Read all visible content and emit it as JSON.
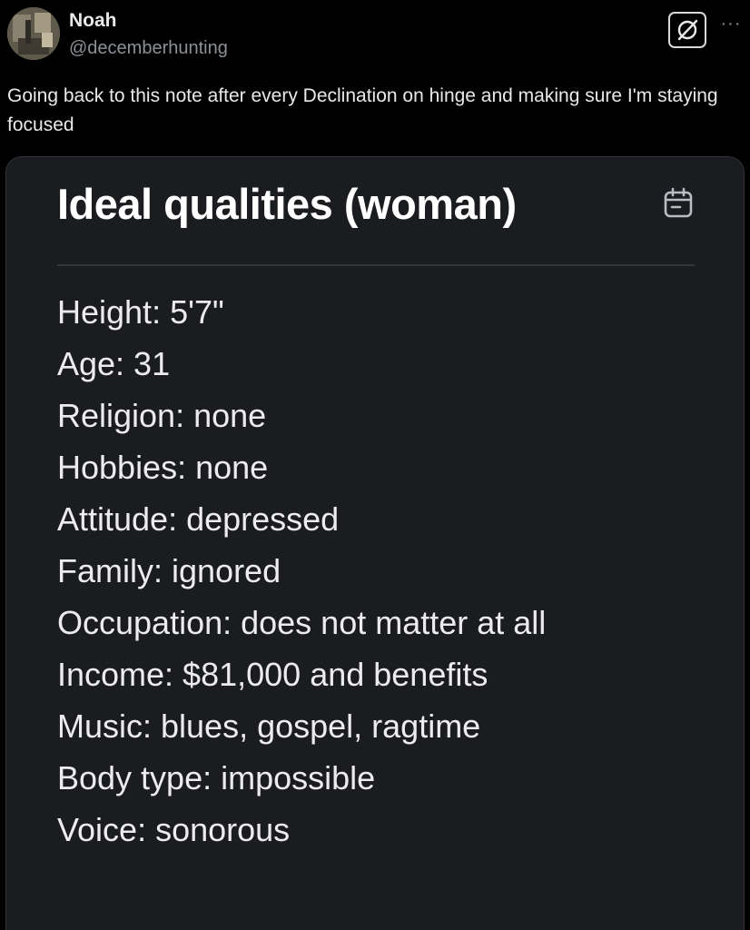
{
  "author": {
    "name": "Noah",
    "handle": "@decemberhunting"
  },
  "header_actions": {
    "grok_icon": "slashed-circle-icon",
    "more_label": "···"
  },
  "tweet": {
    "text": "Going back to this note after every Declination on hinge and making sure I'm staying focused"
  },
  "note": {
    "title": "Ideal qualities (woman)",
    "title_icon": "calendar-icon",
    "lines": [
      "Height: 5'7\"",
      "Age: 31",
      "Religion: none",
      "Hobbies: none",
      "Attitude: depressed",
      "Family: ignored",
      "Occupation: does not matter at all",
      "Income: $81,000 and benefits",
      "Music: blues, gospel, ragtime",
      "Body type: impossible",
      "Voice: sonorous"
    ]
  },
  "colors": {
    "background": "#000000",
    "note_background": "#1b1c20",
    "text_primary": "#e7e9ea",
    "text_secondary": "#8b9096"
  }
}
